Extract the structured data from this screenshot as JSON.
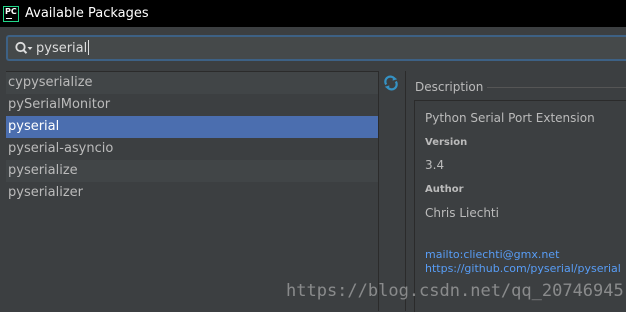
{
  "window": {
    "title": "Available Packages",
    "app_icon_text": "PC"
  },
  "search": {
    "value": "pyserial"
  },
  "packages": [
    {
      "name": "cypyserialize",
      "selected": false
    },
    {
      "name": "pySerialMonitor",
      "selected": false
    },
    {
      "name": "pyserial",
      "selected": true
    },
    {
      "name": "pyserial-asyncio",
      "selected": false
    },
    {
      "name": "pyserialize",
      "selected": false
    },
    {
      "name": "pyserializer",
      "selected": false
    }
  ],
  "toolbar": {
    "reload_icon": "reload-icon"
  },
  "description": {
    "header": "Description",
    "summary": "Python Serial Port Extension",
    "version_label": "Version",
    "version": "3.4",
    "author_label": "Author",
    "author": "Chris Liechti",
    "email_link": "mailto:cliechti@gmx.net",
    "homepage_link": "https://github.com/pyserial/pyserial"
  },
  "watermark": "https://blog.csdn.net/qq_20746945",
  "colors": {
    "selection": "#4b6eaf",
    "link": "#589df6",
    "focus_border": "#3d6185"
  }
}
